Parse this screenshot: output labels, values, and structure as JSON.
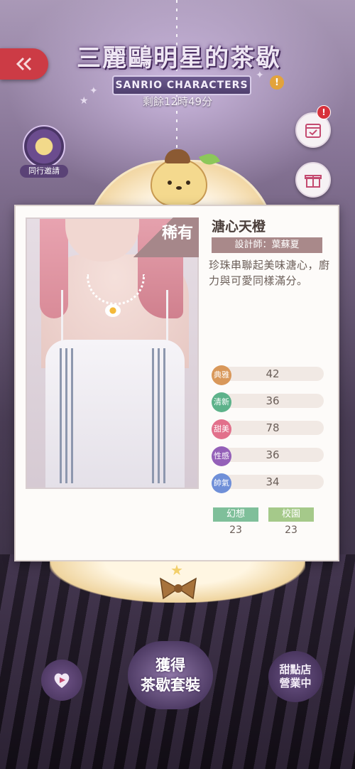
{
  "event": {
    "title": "三麗鷗明星的茶歇",
    "subtitle": "SANRIO CHARACTERS",
    "timer": "剩餘12時49分",
    "alert_symbol": "!"
  },
  "side_menu": {
    "companion_label": "同行邀請"
  },
  "item_card": {
    "rarity": "稀有",
    "name": "溏心天橙",
    "designer": "設計師：葉蘇夏",
    "description": "珍珠串聯起美味溏心，廚力與可愛同樣滿分。",
    "stats": [
      {
        "label": "典雅",
        "value": "42",
        "color": "#d9985a"
      },
      {
        "label": "清新",
        "value": "36",
        "color": "#5db28a"
      },
      {
        "label": "甜美",
        "value": "78",
        "color": "#e2708b"
      },
      {
        "label": "性感",
        "value": "36",
        "color": "#9460b8"
      },
      {
        "label": "帥氣",
        "value": "34",
        "color": "#6f8fd8"
      }
    ],
    "tags": [
      {
        "label": "幻想",
        "value": "23",
        "color": "#7fbf9a"
      },
      {
        "label": "校園",
        "value": "23",
        "color": "#a5c98a"
      }
    ]
  },
  "bottom": {
    "obtain_line1": "獲得",
    "obtain_line2": "茶歇套裝",
    "shop_line1": "甜點店",
    "shop_line2": "營業中"
  },
  "icons": {
    "back": "double-chevron-left-icon",
    "calendar": "calendar-check-icon",
    "gift": "gift-icon",
    "play": "play-icon"
  },
  "colors": {
    "back_button": "#cc3b45",
    "alert": "#d7323c",
    "rarity_banner": "#a6878a",
    "designer_bar": "#a9898a"
  }
}
